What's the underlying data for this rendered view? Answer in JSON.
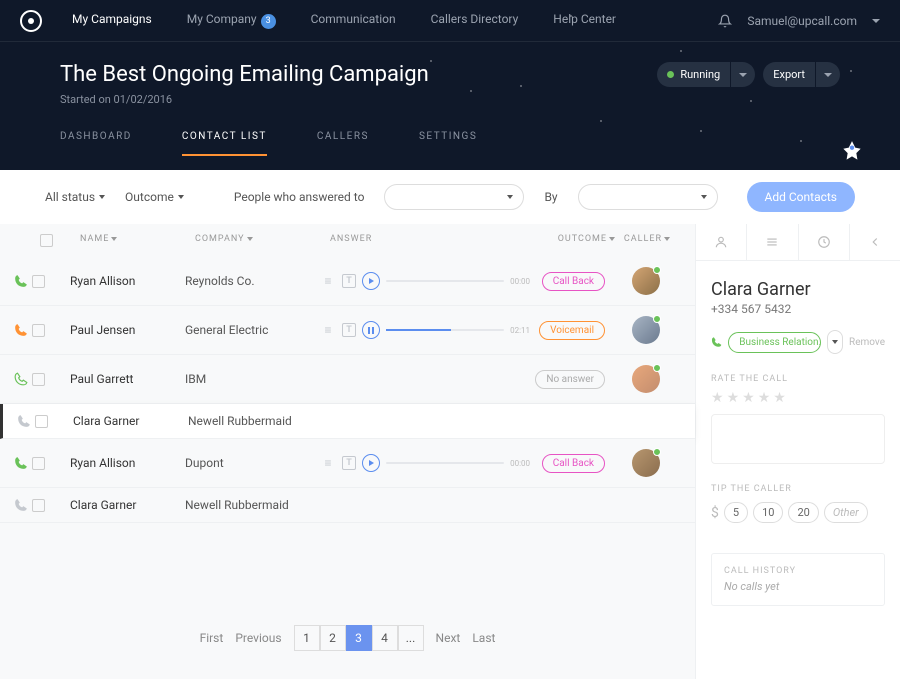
{
  "nav": {
    "items": [
      {
        "label": "My Campaigns",
        "active": true
      },
      {
        "label": "My Company",
        "badge": "3"
      },
      {
        "label": "Communication"
      },
      {
        "label": "Callers Directory"
      },
      {
        "label": "Help Center"
      }
    ],
    "user": "Samuel@upcall.com"
  },
  "campaign": {
    "title": "The Best Ongoing Emailing Campaign",
    "started": "Started on 01/02/2016",
    "status": "Running",
    "export": "Export"
  },
  "tabs": [
    {
      "label": "DASHBOARD"
    },
    {
      "label": "CONTACT LIST",
      "active": true
    },
    {
      "label": "CALLERS"
    },
    {
      "label": "SETTINGS"
    }
  ],
  "filters": {
    "status": "All status",
    "outcome": "Outcome",
    "answered": "People who answered to",
    "by": "By",
    "add": "Add Contacts"
  },
  "table": {
    "head": {
      "name": "NAME",
      "company": "COMPANY",
      "answer": "ANSWER",
      "outcome": "OUTCOME",
      "caller": "CALLER"
    }
  },
  "rows": [
    {
      "phone_color": "#6ac259",
      "name": "Ryan Allison",
      "company": "Reynolds Co.",
      "time": "00:00",
      "outcome": "Call Back",
      "outcome_cls": "badge-pink",
      "avatar": "avatar",
      "playing": false,
      "fill": "0%",
      "has_audio": true
    },
    {
      "phone_color": "#ff9234",
      "name": "Paul Jensen",
      "company": "General Electric",
      "time": "02:11",
      "outcome": "Voicemail",
      "outcome_cls": "badge-orange",
      "avatar": "avatar2",
      "playing": true,
      "fill": "55%",
      "has_audio": true
    },
    {
      "phone_color": "#6ac259",
      "phone_outline": true,
      "name": "Paul Garrett",
      "company": "IBM",
      "outcome": "No answer",
      "outcome_cls": "badge-gray",
      "avatar": "avatar3",
      "has_audio": false
    },
    {
      "phone_color": "#c5c9cf",
      "name": "Clara Garner",
      "company": "Newell Rubbermaid",
      "selected": true,
      "has_audio": false
    },
    {
      "phone_color": "#6ac259",
      "name": "Ryan Allison",
      "company": "Dupont",
      "time": "00:00",
      "outcome": "Call Back",
      "outcome_cls": "badge-pink",
      "avatar": "avatar4",
      "playing": false,
      "fill": "0%",
      "has_audio": true
    },
    {
      "phone_color": "#c5c9cf",
      "name": "Clara Garner",
      "company": "Newell Rubbermaid",
      "has_audio": false
    }
  ],
  "pagination": {
    "first": "First",
    "prev": "Previous",
    "pages": [
      "1",
      "2",
      "3",
      "4",
      "..."
    ],
    "active": "3",
    "next": "Next",
    "last": "Last"
  },
  "detail": {
    "name": "Clara Garner",
    "phone": "+334 567 5432",
    "relation": "Business Relation...",
    "remove": "Remove",
    "rate_label": "RATE THE CALL",
    "tip_label": "TIP THE CALLER",
    "tips": [
      "5",
      "10",
      "20"
    ],
    "tip_other": "Other",
    "history_label": "CALL HISTORY",
    "history_text": "No calls yet"
  }
}
